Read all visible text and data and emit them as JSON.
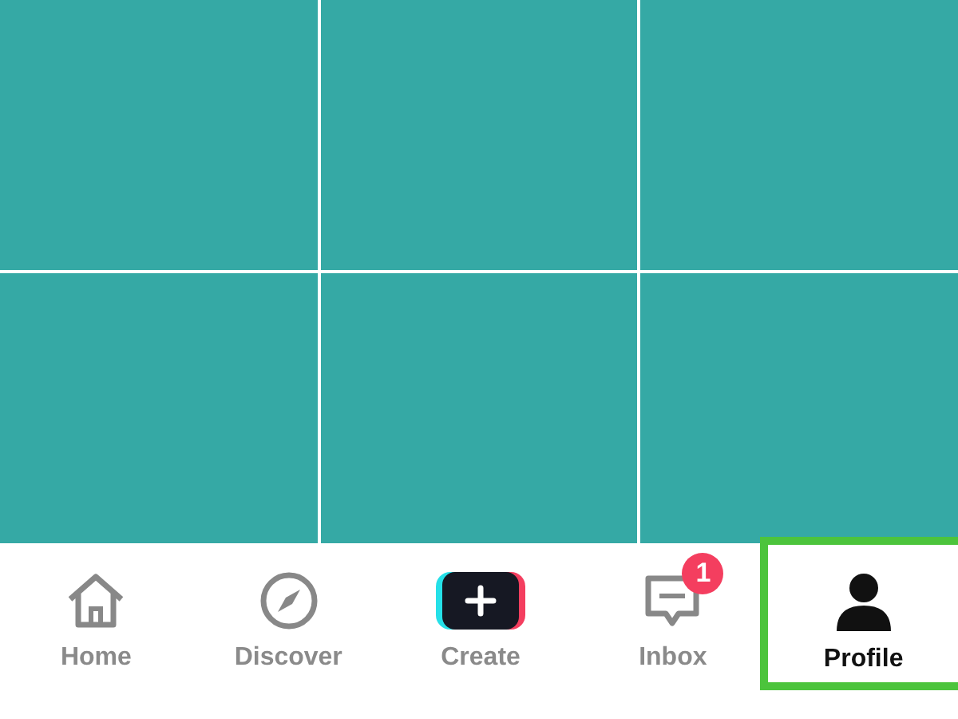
{
  "nav_items": [
    {
      "kind": "home",
      "label": "Home",
      "selected": false,
      "highlighted": false
    },
    {
      "kind": "discover",
      "label": "Discover",
      "selected": false,
      "highlighted": false
    },
    {
      "kind": "create",
      "label": "Create",
      "selected": false,
      "highlighted": false
    },
    {
      "kind": "inbox",
      "label": "Inbox",
      "selected": false,
      "highlighted": false,
      "badge": "1"
    },
    {
      "kind": "profile",
      "label": "Profile",
      "selected": true,
      "highlighted": true
    }
  ]
}
